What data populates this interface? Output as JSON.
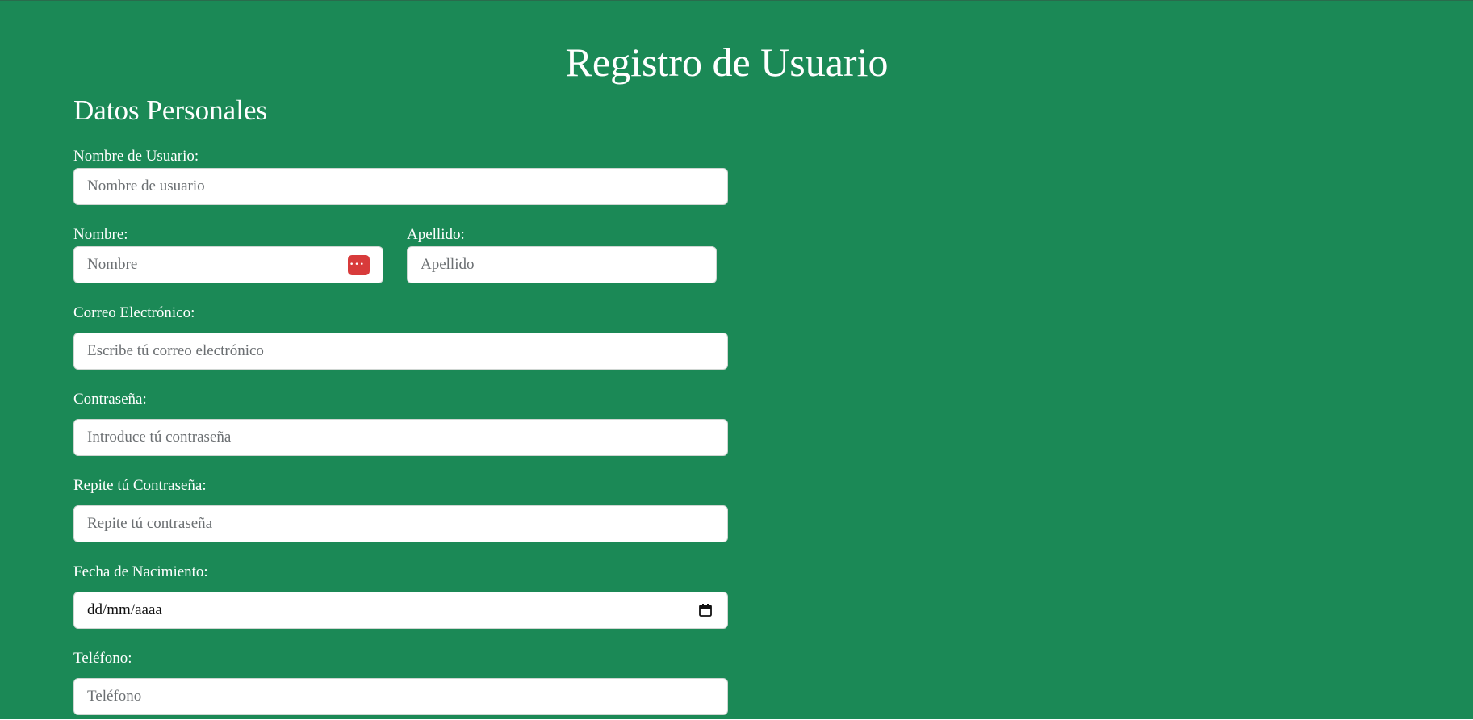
{
  "page": {
    "title": "Registro de Usuario",
    "section_title": "Datos Personales",
    "background_color": "#1b8956"
  },
  "form": {
    "username": {
      "label": "Nombre de Usuario:",
      "placeholder": "Nombre de usuario"
    },
    "first_name": {
      "label": "Nombre:",
      "placeholder": "Nombre",
      "icon": "password-manager-icon"
    },
    "last_name": {
      "label": "Apellido:",
      "placeholder": "Apellido"
    },
    "email": {
      "label": "Correo Electrónico:",
      "placeholder": "Escribe tú correo electrónico"
    },
    "password": {
      "label": "Contraseña:",
      "placeholder": "Introduce tú contraseña"
    },
    "password_repeat": {
      "label": "Repite tú Contraseña:",
      "placeholder": "Repite tú contraseña"
    },
    "birth_date": {
      "label": "Fecha de Nacimiento:",
      "value": "dd/mm/aaaa",
      "icon": "calendar-icon"
    },
    "phone": {
      "label": "Teléfono:",
      "placeholder": "Teléfono"
    }
  }
}
